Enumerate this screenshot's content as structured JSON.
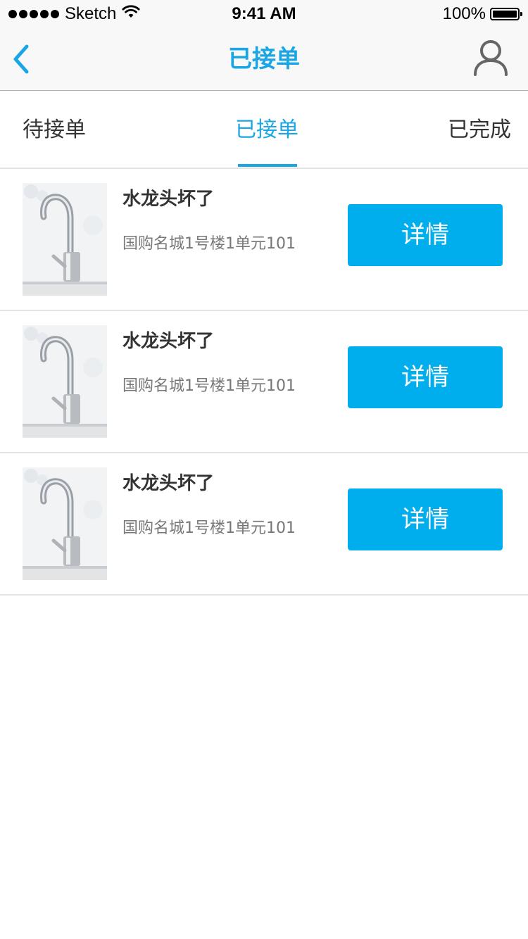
{
  "status_bar": {
    "carrier": "Sketch",
    "time": "9:41 AM",
    "battery": "100%",
    "signal_icon": "signal-dots-icon",
    "wifi_icon": "wifi-icon",
    "battery_icon": "battery-icon"
  },
  "nav": {
    "title": "已接单",
    "back_icon": "chevron-left-icon",
    "user_icon": "user-profile-icon"
  },
  "tabs": [
    {
      "label": "待接单",
      "active": false
    },
    {
      "label": "已接单",
      "active": true
    },
    {
      "label": "已完成",
      "active": false
    }
  ],
  "orders": [
    {
      "title": "水龙头坏了",
      "address": "国购名城1号楼1单元101",
      "button": "详情",
      "image": "faucet-photo"
    },
    {
      "title": "水龙头坏了",
      "address": "国购名城1号楼1单元101",
      "button": "详情",
      "image": "faucet-photo"
    },
    {
      "title": "水龙头坏了",
      "address": "国购名城1号楼1单元101",
      "button": "详情",
      "image": "faucet-photo"
    }
  ],
  "colors": {
    "accent": "#1aa6e4",
    "button": "#00aeee",
    "divider": "#e3e3e3"
  }
}
